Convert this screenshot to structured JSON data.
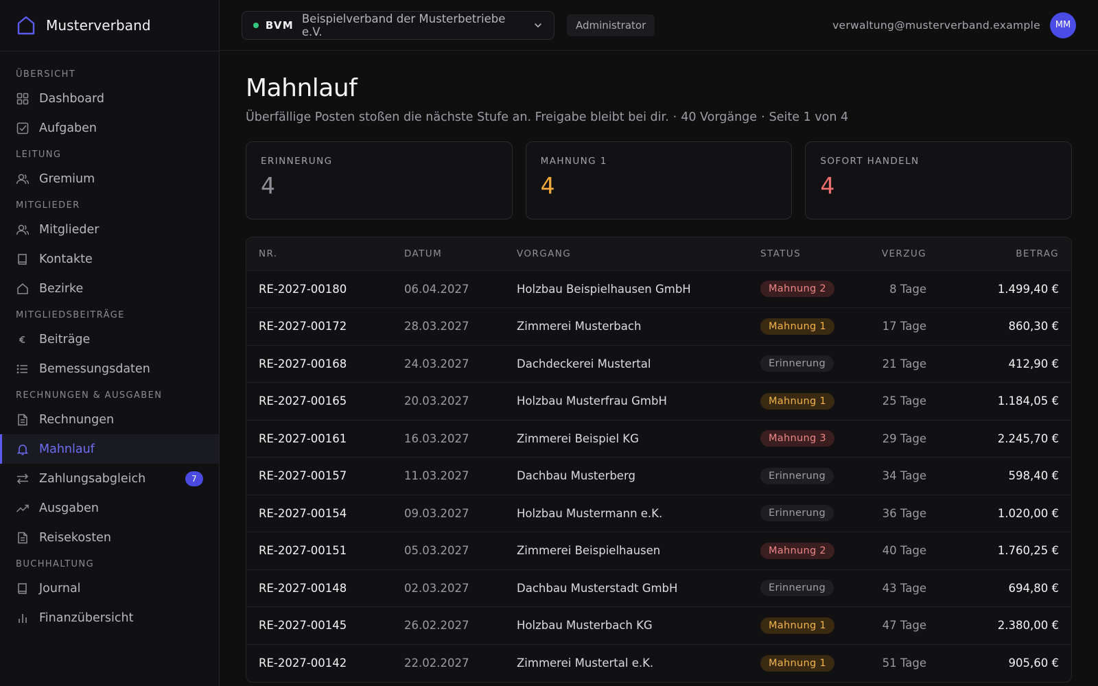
{
  "brand": {
    "name": "Musterverband"
  },
  "sidebar": {
    "sections": [
      {
        "title": "Übersicht",
        "items": [
          {
            "label": "Dashboard",
            "icon": "grid-icon"
          },
          {
            "label": "Aufgaben",
            "icon": "checkbox-icon"
          }
        ]
      },
      {
        "title": "Leitung",
        "items": [
          {
            "label": "Gremium",
            "icon": "users-icon"
          }
        ]
      },
      {
        "title": "Mitglieder",
        "items": [
          {
            "label": "Mitglieder",
            "icon": "users-icon"
          },
          {
            "label": "Kontakte",
            "icon": "book-icon"
          },
          {
            "label": "Bezirke",
            "icon": "home-icon"
          }
        ]
      },
      {
        "title": "Mitgliedsbeiträge",
        "items": [
          {
            "label": "Beiträge",
            "icon": "euro-icon"
          },
          {
            "label": "Bemessungsdaten",
            "icon": "list-icon"
          }
        ]
      },
      {
        "title": "Rechnungen & Ausgaben",
        "items": [
          {
            "label": "Rechnungen",
            "icon": "document-icon"
          },
          {
            "label": "Mahnlauf",
            "icon": "bell-icon",
            "active": true
          },
          {
            "label": "Zahlungsabgleich",
            "icon": "arrows-icon",
            "badge": "7"
          },
          {
            "label": "Ausgaben",
            "icon": "trend-icon"
          },
          {
            "label": "Reisekosten",
            "icon": "document-icon"
          }
        ]
      },
      {
        "title": "Buchhaltung",
        "items": [
          {
            "label": "Journal",
            "icon": "book-icon"
          },
          {
            "label": "Finanzübersicht",
            "icon": "bar-chart-icon"
          }
        ]
      }
    ]
  },
  "topbar": {
    "org_code": "BVM",
    "org_name": "Beispielverband der Musterbetriebe e.V.",
    "role": "Administrator",
    "email": "verwaltung@musterverband.example",
    "avatar_initials": "MM"
  },
  "page": {
    "title": "Mahnlauf",
    "subtitle": "Überfällige Posten stoßen die nächste Stufe an. Freigabe bleibt bei dir.",
    "count": "40 Vorgänge",
    "pagination": "Seite 1 von 4"
  },
  "cards": [
    {
      "label": "Erinnerung",
      "value": "4",
      "color": "#8f8f98"
    },
    {
      "label": "Mahnung 1",
      "value": "4",
      "color": "#f2a93b"
    },
    {
      "label": "Sofort handeln",
      "value": "4",
      "color": "#ee6f6f"
    }
  ],
  "table": {
    "headers": {
      "nr": "Nr.",
      "date": "Datum",
      "process": "Vorgang",
      "status": "Status",
      "delay": "Verzug",
      "amount": "Betrag"
    },
    "rows": [
      {
        "nr": "RE-2027-00180",
        "date": "06.04.2027",
        "process": "Holzbau Beispielhausen GmbH",
        "status": "Mahnung 2",
        "delay": "8 Tage",
        "amount": "1.499,40 €"
      },
      {
        "nr": "RE-2027-00172",
        "date": "28.03.2027",
        "process": "Zimmerei Musterbach",
        "status": "Mahnung 1",
        "delay": "17 Tage",
        "amount": "860,30 €"
      },
      {
        "nr": "RE-2027-00168",
        "date": "24.03.2027",
        "process": "Dachdeckerei Mustertal",
        "status": "Erinnerung",
        "delay": "21 Tage",
        "amount": "412,90 €"
      },
      {
        "nr": "RE-2027-00165",
        "date": "20.03.2027",
        "process": "Holzbau Musterfrau GmbH",
        "status": "Mahnung 1",
        "delay": "25 Tage",
        "amount": "1.184,05 €"
      },
      {
        "nr": "RE-2027-00161",
        "date": "16.03.2027",
        "process": "Zimmerei Beispiel KG",
        "status": "Mahnung 3",
        "delay": "29 Tage",
        "amount": "2.245,70 €"
      },
      {
        "nr": "RE-2027-00157",
        "date": "11.03.2027",
        "process": "Dachbau Musterberg",
        "status": "Erinnerung",
        "delay": "34 Tage",
        "amount": "598,40 €"
      },
      {
        "nr": "RE-2027-00154",
        "date": "09.03.2027",
        "process": "Holzbau Mustermann e.K.",
        "status": "Erinnerung",
        "delay": "36 Tage",
        "amount": "1.020,00 €"
      },
      {
        "nr": "RE-2027-00151",
        "date": "05.03.2027",
        "process": "Zimmerei Beispielhausen",
        "status": "Mahnung 2",
        "delay": "40 Tage",
        "amount": "1.760,25 €"
      },
      {
        "nr": "RE-2027-00148",
        "date": "02.03.2027",
        "process": "Dachbau Musterstadt GmbH",
        "status": "Erinnerung",
        "delay": "43 Tage",
        "amount": "694,80 €"
      },
      {
        "nr": "RE-2027-00145",
        "date": "26.02.2027",
        "process": "Holzbau Musterbach KG",
        "status": "Mahnung 1",
        "delay": "47 Tage",
        "amount": "2.380,00 €"
      },
      {
        "nr": "RE-2027-00142",
        "date": "22.02.2027",
        "process": "Zimmerei Mustertal e.K.",
        "status": "Mahnung 1",
        "delay": "51 Tage",
        "amount": "905,60 €"
      }
    ]
  }
}
